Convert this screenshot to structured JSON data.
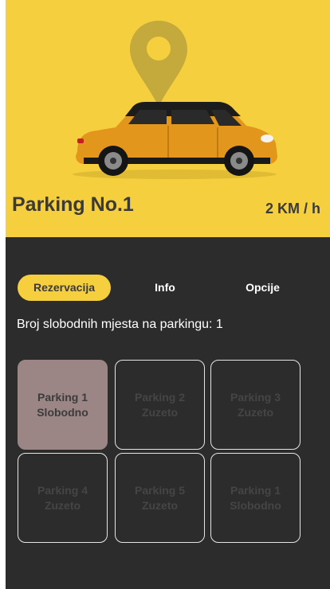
{
  "header": {
    "title": "Parking No.1",
    "speed": "2 KM / h"
  },
  "icons": {
    "pin": "location-pin-icon",
    "car": "car-illustration"
  },
  "colors": {
    "accent": "#f5cf3d",
    "background": "#2c2c2c",
    "free_spot": "#9b8585"
  },
  "tabs": [
    {
      "label": "Rezervacija",
      "active": true
    },
    {
      "label": "Info",
      "active": false
    },
    {
      "label": "Opcije",
      "active": false
    }
  ],
  "free_spots_text": "Broj slobodnih mjesta na parkingu: 1",
  "spots": [
    {
      "name": "Parking 1",
      "status": "Slobodno"
    },
    {
      "name": "Parking 2",
      "status": "Zuzeto"
    },
    {
      "name": "Parking 3",
      "status": "Zuzeto"
    },
    {
      "name": "Parking 4",
      "status": "Zuzeto"
    },
    {
      "name": "Parking 5",
      "status": "Zuzeto"
    },
    {
      "name": "Parking 1",
      "status": "Slobodno"
    }
  ]
}
